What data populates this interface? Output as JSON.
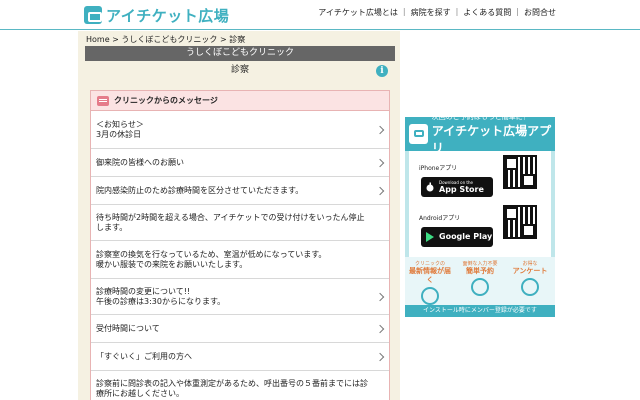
{
  "header": {
    "logo_text": "アイチケット広場",
    "nav": [
      "アイチケット広場とは",
      "病院を探す",
      "よくある質問",
      "お問合せ"
    ]
  },
  "breadcrumb": [
    "Home",
    "うしくぼこどもクリニック",
    "診察"
  ],
  "clinic_name": "うしくぼこどもクリニック",
  "section_title": "診察",
  "messages": {
    "heading": "クリニックからのメッセージ",
    "items": [
      {
        "line1": "＜お知らせ＞",
        "line2": "3月の休診日"
      },
      {
        "line1": "御来院の皆様へのお願い",
        "line2": ""
      },
      {
        "line1": "院内感染防止のため診療時間を区分させていただきます。",
        "line2": ""
      },
      {
        "line1": "待ち時間が2時間を超える場合、アイチケットでの受け付けをいったん停止します。",
        "line2": ""
      },
      {
        "line1": "診察室の換気を行なっているため、室温が低めになっています。",
        "line2": "暖かい服装での来院をお願いいたします。"
      },
      {
        "line1": "診療時間の変更について!!",
        "line2": "午後の診療は3:30からになります。"
      },
      {
        "line1": "受付時間について",
        "line2": ""
      },
      {
        "line1": "「すぐいく」ご利用の方へ",
        "line2": ""
      },
      {
        "line1": "診察前に問診表の記入や体重測定があるため、呼出番号の５番前までには診",
        "line2": "療所にお越しください。"
      }
    ]
  },
  "ad": {
    "tagline": "次回のご予約はもっと簡単に！",
    "app_name": "アイチケット広場アプリ",
    "iphone_label": "iPhoneアプリ",
    "appstore_small": "Download on the",
    "appstore_big": "App Store",
    "android_label": "Androidアプリ",
    "gplay_small": "",
    "gplay_big": "Google Play",
    "features": [
      {
        "top": "クリニックの",
        "bottom": "最新情報が届く"
      },
      {
        "top": "面倒な入力不要",
        "bottom": "簡単予約"
      },
      {
        "top": "お得な",
        "bottom": "アンケート"
      }
    ],
    "footer": "インストール時にメンバー登録が必要です"
  }
}
